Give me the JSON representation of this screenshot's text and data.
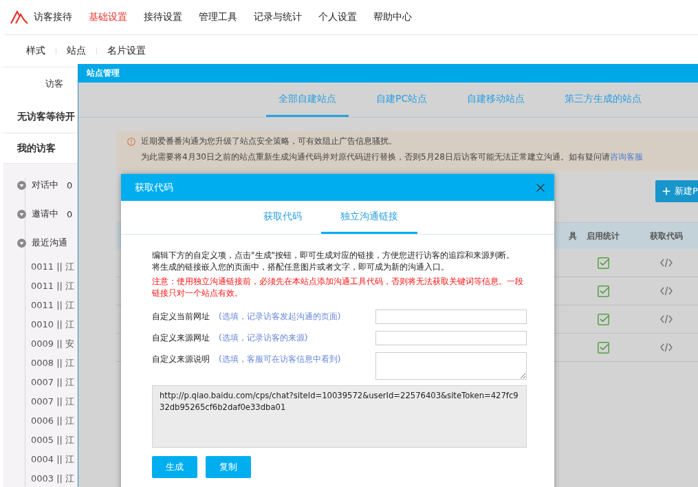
{
  "top_nav": {
    "items": [
      {
        "label": "访客接待",
        "selected": false
      },
      {
        "label": "基础设置",
        "selected": true
      },
      {
        "label": "接待设置",
        "selected": false
      },
      {
        "label": "管理工具",
        "selected": false
      },
      {
        "label": "记录与统计",
        "selected": false
      },
      {
        "label": "个人设置",
        "selected": false
      },
      {
        "label": "帮助中心",
        "selected": false
      }
    ]
  },
  "sub_nav": {
    "items": [
      "样式",
      "站点",
      "名片设置"
    ]
  },
  "sidebar": {
    "header": "访客",
    "waiting": "无访客等待开",
    "section_title": "我的访客",
    "groups": [
      {
        "label": "对话中",
        "count": "0"
      },
      {
        "label": "邀请中",
        "count": "0"
      },
      {
        "label": "最近沟通",
        "children": [
          {
            "label": "0011 || 江"
          },
          {
            "label": "0011 || 江"
          },
          {
            "label": "0011 || 江"
          },
          {
            "label": "0010 || 江"
          },
          {
            "label": "0009 || 安"
          },
          {
            "label": "0008 || 江"
          },
          {
            "label": "0007 || 江"
          },
          {
            "label": "0007 || 江"
          },
          {
            "label": "0006 || 江"
          },
          {
            "label": "0005 || 江"
          },
          {
            "label": "0004 || 江"
          },
          {
            "label": "0003 || 江"
          }
        ]
      }
    ]
  },
  "panel": {
    "title": "站点管理",
    "tabs": [
      {
        "label": "全部自建站点",
        "selected": true
      },
      {
        "label": "自建PC站点",
        "selected": false
      },
      {
        "label": "自建移动站点",
        "selected": false
      },
      {
        "label": "第三方生成的站点",
        "selected": false
      }
    ],
    "notice": {
      "line_1": "近期爱番番沟通为您升级了站点安全策略，可有效阻止广告信息骚扰。",
      "line_2": "为此需要将4月30日之前的站点重新生成沟通代码并对原代码进行替换，否则5月28日后访客可能无法正常建立沟通。如有疑问请",
      "link": "咨询客服"
    },
    "new_button": "新建P",
    "table": {
      "columns": [
        "具",
        "启用统计",
        "获取代码"
      ],
      "rows": [
        {
          "stats_enabled": true
        },
        {
          "stats_enabled": true
        },
        {
          "stats_enabled": true
        },
        {
          "stats_enabled": true
        }
      ]
    }
  },
  "dialog": {
    "title": "获取代码",
    "tabs": [
      {
        "label": "获取代码",
        "selected": false
      },
      {
        "label": "独立沟通链接",
        "selected": true
      }
    ],
    "description": [
      "编辑下方的自定义项，点击\"生成\"按钮，即可生成对应的链接，方便您进行访客的追踪和来源判断。",
      "将生成的链接嵌入您的页面中，搭配任意图片或者文字，即可成为新的沟通入口。"
    ],
    "warning": "注意：使用独立沟通链接前，必须先在本站点添加沟通工具代码，否则将无法获取关键词等信息。一段链接只对一个站点有效。",
    "fields": [
      {
        "label": "自定义当前网址",
        "hint": "(选填，记录访客发起沟通的页面)",
        "kind": "input"
      },
      {
        "label": "自定义来源网址",
        "hint": "(选填，记录访客的来源)",
        "kind": "input"
      },
      {
        "label": "自定义来源说明",
        "hint": "(选填，客服可在访客信息中看到)",
        "kind": "textarea"
      }
    ],
    "link_output": "http://p.qiao.baidu.com/cps/chat?siteId=10039572&userId=22576403&siteToken=427fc932db95265cf6b2daf0e33dba01",
    "buttons": [
      "生成",
      "复制"
    ]
  }
}
